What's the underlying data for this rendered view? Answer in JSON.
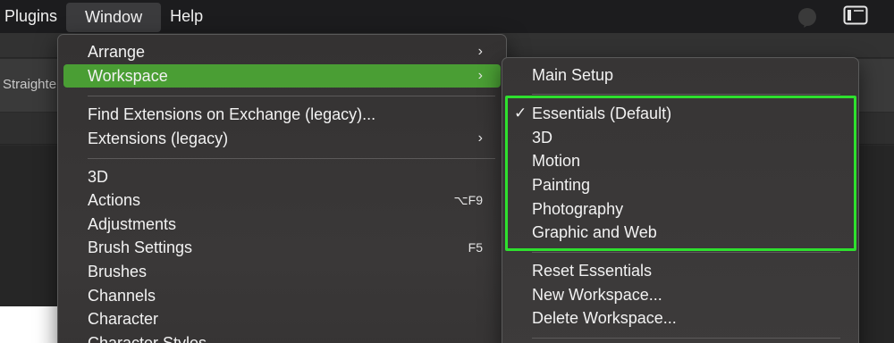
{
  "menubar": {
    "items": [
      "Plugins",
      "Window",
      "Help"
    ]
  },
  "options_bar": {
    "straighten_label": "Straighten"
  },
  "window_menu": {
    "items": [
      {
        "label": "Arrange",
        "submenu": true
      },
      {
        "label": "Workspace",
        "submenu": true,
        "highlighted": true
      },
      {
        "label": "Find Extensions on Exchange (legacy)..."
      },
      {
        "label": "Extensions (legacy)",
        "submenu": true
      },
      {
        "label": "3D"
      },
      {
        "label": "Actions",
        "shortcut": "⌥F9"
      },
      {
        "label": "Adjustments"
      },
      {
        "label": "Brush Settings",
        "shortcut": "F5"
      },
      {
        "label": "Brushes"
      },
      {
        "label": "Channels"
      },
      {
        "label": "Character"
      },
      {
        "label": "Character Styles"
      }
    ]
  },
  "workspace_menu": {
    "items": [
      {
        "label": "Main Setup"
      },
      {
        "label": "Essentials (Default)",
        "checked": true
      },
      {
        "label": "3D"
      },
      {
        "label": "Motion"
      },
      {
        "label": "Painting"
      },
      {
        "label": "Photography"
      },
      {
        "label": "Graphic and Web"
      },
      {
        "label": "Reset Essentials"
      },
      {
        "label": "New Workspace..."
      },
      {
        "label": "Delete Workspace..."
      }
    ],
    "check_mark": "✓"
  },
  "glyphs": {
    "chevron": "›"
  },
  "colors": {
    "highlight": "#4a9e34",
    "annotation_box": "#2ee02e"
  },
  "icons": [
    "moon-icon",
    "window-icon",
    "chevron-right-icon",
    "checkmark-icon"
  ]
}
